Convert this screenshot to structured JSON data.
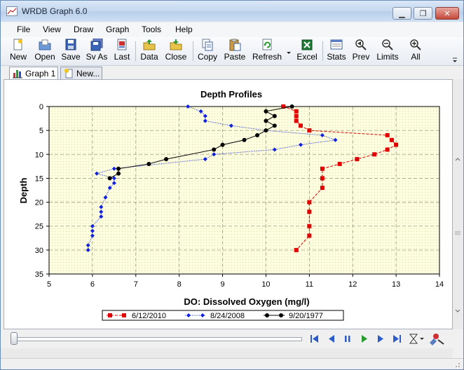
{
  "window": {
    "title": "WRDB Graph 6.0"
  },
  "menu": [
    "File",
    "View",
    "Draw",
    "Graph",
    "Tools",
    "Help"
  ],
  "toolbar": {
    "new": "New",
    "open": "Open",
    "save": "Save",
    "save_as": "Sv As",
    "last": "Last",
    "data": "Data",
    "close": "Close",
    "copy": "Copy",
    "paste": "Paste",
    "refresh": "Refresh",
    "excel": "Excel",
    "stats": "Stats",
    "prev": "Prev",
    "limits": "Limits",
    "all": "All"
  },
  "tabs": [
    {
      "label": "Graph 1",
      "active": true
    },
    {
      "label": "New...",
      "active": false
    }
  ],
  "slider": {
    "position": 0
  },
  "chart_data": {
    "type": "line",
    "title": "Depth Profiles",
    "xlabel": "DO: Dissolved Oxygen (mg/l)",
    "ylabel": "Depth",
    "xlim": [
      5,
      14
    ],
    "ylim": [
      35,
      0
    ],
    "x_ticks": [
      "5",
      "6",
      "7",
      "8",
      "9",
      "10",
      "11",
      "12",
      "13",
      "14"
    ],
    "y_ticks": [
      "0",
      "5",
      "10",
      "15",
      "20",
      "25",
      "30",
      "35"
    ],
    "grid": true,
    "legend_position": "bottom",
    "series": [
      {
        "name": "6/12/2010",
        "color": "#e00000",
        "marker": "square",
        "line_style": "dashed",
        "points": [
          [
            10.4,
            0
          ],
          [
            10.7,
            1
          ],
          [
            10.7,
            2
          ],
          [
            10.7,
            3
          ],
          [
            10.8,
            4
          ],
          [
            11.0,
            5
          ],
          [
            12.8,
            6
          ],
          [
            12.9,
            7
          ],
          [
            13.0,
            8
          ],
          [
            12.8,
            9
          ],
          [
            12.5,
            10
          ],
          [
            12.1,
            11
          ],
          [
            11.7,
            12
          ],
          [
            11.3,
            13
          ],
          [
            11.3,
            15
          ],
          [
            11.3,
            17
          ],
          [
            11.0,
            20
          ],
          [
            11.0,
            22
          ],
          [
            11.0,
            25
          ],
          [
            11.0,
            27
          ],
          [
            10.7,
            30
          ]
        ]
      },
      {
        "name": "8/24/2008",
        "color": "#1020e0",
        "marker": "diamond",
        "line_style": "dotted",
        "points": [
          [
            8.2,
            0
          ],
          [
            8.5,
            1
          ],
          [
            8.6,
            2
          ],
          [
            8.6,
            3
          ],
          [
            9.2,
            4
          ],
          [
            10.0,
            5
          ],
          [
            11.3,
            6
          ],
          [
            11.6,
            7
          ],
          [
            10.8,
            8
          ],
          [
            10.2,
            9
          ],
          [
            8.8,
            10
          ],
          [
            8.6,
            11
          ],
          [
            6.5,
            13
          ],
          [
            6.1,
            14
          ],
          [
            6.5,
            15
          ],
          [
            6.5,
            16
          ],
          [
            6.4,
            17
          ],
          [
            6.3,
            19
          ],
          [
            6.2,
            21
          ],
          [
            6.2,
            22
          ],
          [
            6.2,
            23
          ],
          [
            6.0,
            25
          ],
          [
            6.0,
            26
          ],
          [
            6.0,
            27
          ],
          [
            5.9,
            29
          ],
          [
            5.9,
            30
          ]
        ]
      },
      {
        "name": "9/20/1977",
        "color": "#000000",
        "marker": "circle",
        "line_style": "solid",
        "points": [
          [
            10.6,
            0
          ],
          [
            10.0,
            1
          ],
          [
            10.2,
            2
          ],
          [
            10.0,
            3
          ],
          [
            10.2,
            4
          ],
          [
            10.0,
            5
          ],
          [
            9.8,
            6
          ],
          [
            9.5,
            7
          ],
          [
            9.0,
            8
          ],
          [
            8.8,
            9
          ],
          [
            7.7,
            11
          ],
          [
            7.3,
            12
          ],
          [
            6.6,
            13
          ],
          [
            6.6,
            14
          ],
          [
            6.4,
            15
          ]
        ]
      }
    ]
  }
}
